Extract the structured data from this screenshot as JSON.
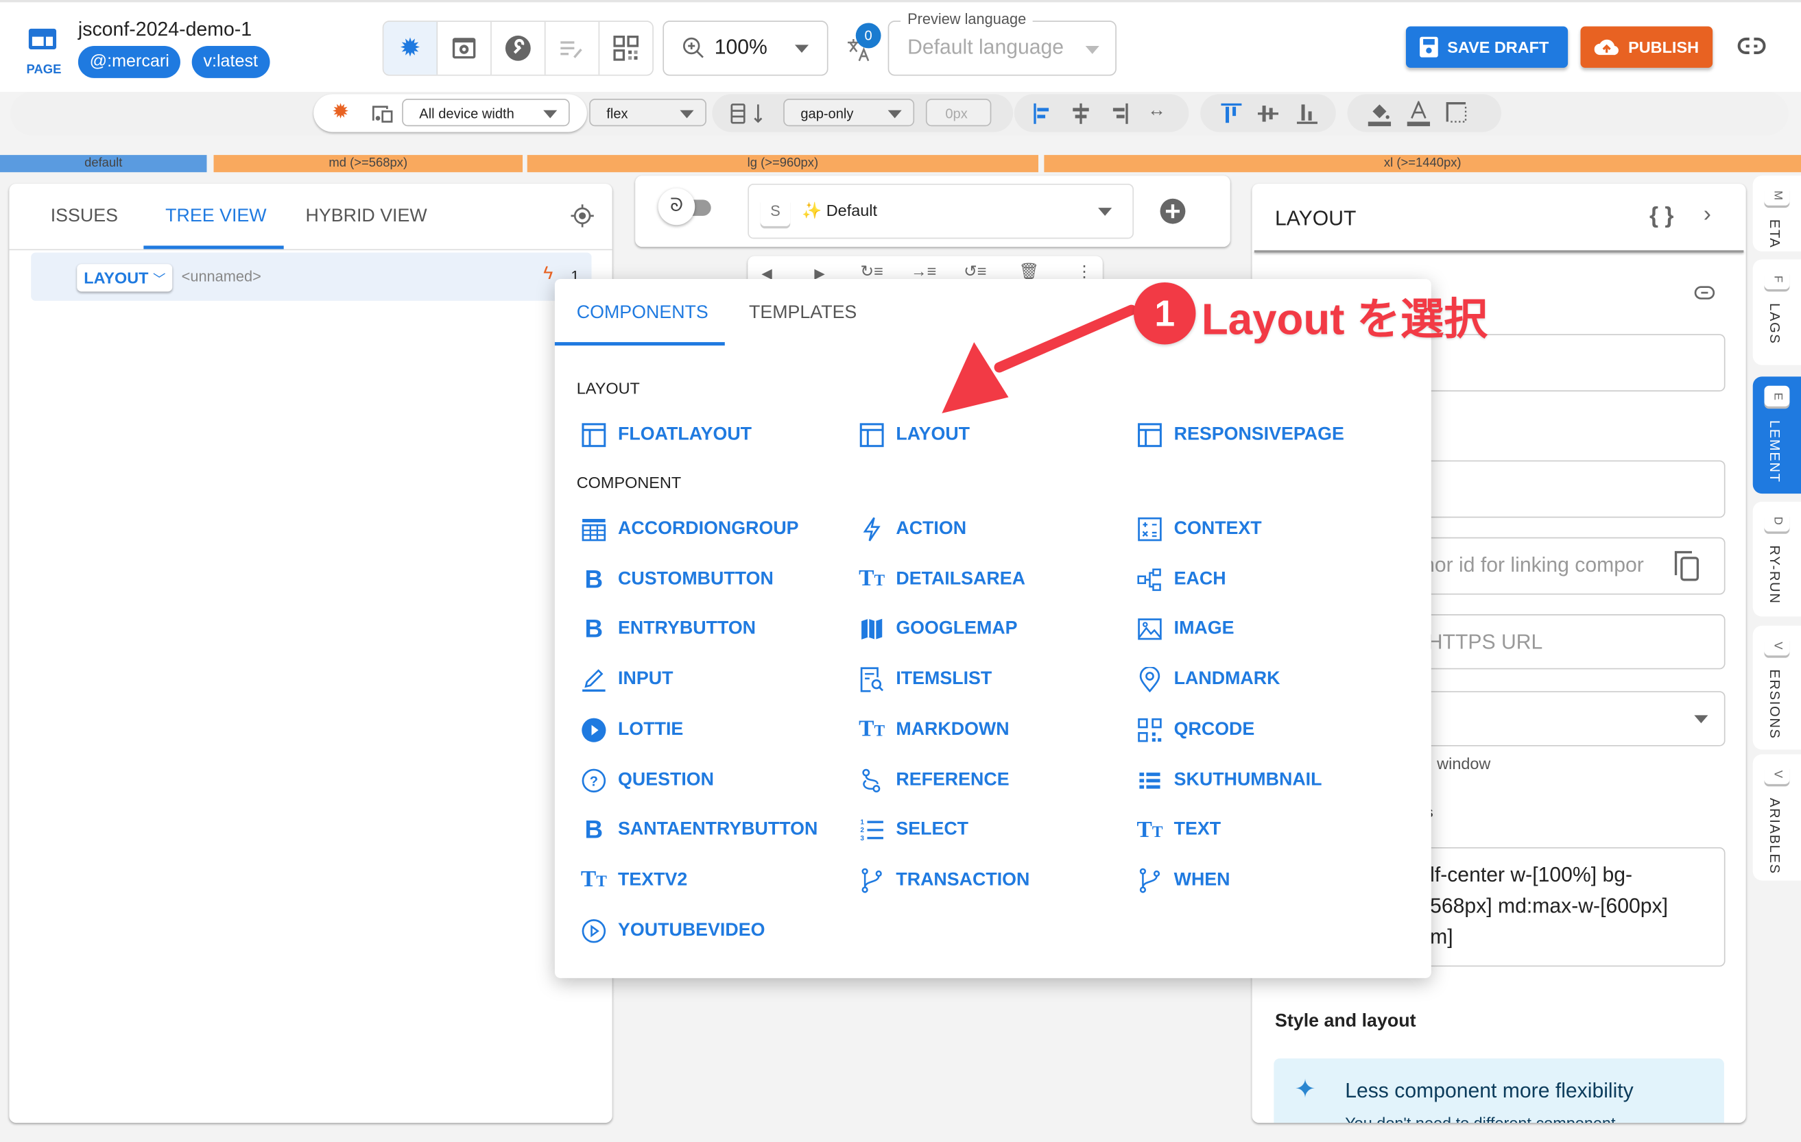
{
  "header": {
    "page_label": "PAGE",
    "title": "jsconf-2024-demo-1",
    "chips": [
      "@:mercari",
      "v:latest"
    ],
    "zoom_value": "100%",
    "translation_badge": "0",
    "preview_language_label": "Preview language",
    "preview_language_value": "Default language",
    "save_label": "SAVE DRAFT",
    "publish_label": "PUBLISH"
  },
  "toolbar": {
    "device_width": "All device width",
    "display": "flex",
    "gap_mode": "gap-only",
    "gap_value": "0px"
  },
  "breakpoints": [
    "default",
    "md (>=568px)",
    "lg (>=960px)",
    "xl (>=1440px)"
  ],
  "left_panel": {
    "tabs": [
      "ISSUES",
      "TREE VIEW",
      "HYBRID VIEW"
    ],
    "active_tab": "TREE VIEW",
    "tree_node_type": "LAYOUT",
    "tree_node_name": "<unnamed>",
    "tree_node_count": "1"
  },
  "canvas": {
    "style_key": "S",
    "style_value": "✨ Default"
  },
  "popup": {
    "tabs": [
      "COMPONENTS",
      "TEMPLATES"
    ],
    "active_tab": "COMPONENTS",
    "layout_section": "LAYOUT",
    "layout_items": [
      {
        "label": "FLOATLAYOUT",
        "icon": "layout-icon"
      },
      {
        "label": "LAYOUT",
        "icon": "layout-icon"
      },
      {
        "label": "RESPONSIVEPAGE",
        "icon": "layout-icon"
      }
    ],
    "component_section": "COMPONENT",
    "component_items": [
      {
        "label": "ACCORDIONGROUP",
        "icon": "table-icon"
      },
      {
        "label": "ACTION",
        "icon": "bolt-icon"
      },
      {
        "label": "CONTEXT",
        "icon": "calculator-icon"
      },
      {
        "label": "CUSTOMBUTTON",
        "icon": "bold-b-icon"
      },
      {
        "label": "DETAILSAREA",
        "icon": "text-icon"
      },
      {
        "label": "EACH",
        "icon": "tree-icon"
      },
      {
        "label": "ENTRYBUTTON",
        "icon": "bold-b-icon"
      },
      {
        "label": "GOOGLEMAP",
        "icon": "map-icon"
      },
      {
        "label": "IMAGE",
        "icon": "image-icon"
      },
      {
        "label": "INPUT",
        "icon": "pencil-icon"
      },
      {
        "label": "ITEMSLIST",
        "icon": "list-search-icon"
      },
      {
        "label": "LANDMARK",
        "icon": "location-pin-icon"
      },
      {
        "label": "LOTTIE",
        "icon": "play-circle-icon"
      },
      {
        "label": "MARKDOWN",
        "icon": "text-icon"
      },
      {
        "label": "QRCODE",
        "icon": "qrcode-icon"
      },
      {
        "label": "QUESTION",
        "icon": "help-circle-icon"
      },
      {
        "label": "REFERENCE",
        "icon": "link-nodes-icon"
      },
      {
        "label": "SKUTHUMBNAIL",
        "icon": "list-icon"
      },
      {
        "label": "SANTAENTRYBUTTON",
        "icon": "bold-b-icon"
      },
      {
        "label": "SELECT",
        "icon": "numbered-list-icon"
      },
      {
        "label": "TEXT",
        "icon": "text-icon"
      },
      {
        "label": "TEXTV2",
        "icon": "text-icon"
      },
      {
        "label": "TRANSACTION",
        "icon": "branch-icon"
      },
      {
        "label": "WHEN",
        "icon": "branch-icon"
      },
      {
        "label": "YOUTUBEVIDEO",
        "icon": "play-outline-icon"
      }
    ]
  },
  "annotation": {
    "number": "1",
    "text": "Layout を選択"
  },
  "right_panel": {
    "title": "LAYOUT",
    "anchor_placeholder": "nor id for linking compor",
    "url_placeholder": "HTTPS URL",
    "window_hint": "window",
    "classes_label_fragment": "s",
    "classes_value": "lf-center w-[100%] bg-\n568px] md:max-w-[600px]\nm]",
    "style_section": "Style and layout",
    "info_title": "Less component more flexibility",
    "info_body": "You don't need to different component"
  },
  "side_tabs": [
    {
      "key": "M",
      "label": "ETA"
    },
    {
      "key": "F",
      "label": "LAGS"
    },
    {
      "key": "E",
      "label": "LEMENT",
      "active": true
    },
    {
      "key": "D",
      "label": "RY-RUN"
    },
    {
      "key": "V",
      "label": "ERSIONS"
    },
    {
      "key": "V",
      "label": "ARIABLES"
    }
  ],
  "colors": {
    "primary": "#1f7ae0",
    "publish": "#e86222",
    "annotation": "#f23a45",
    "bp_default": "#5a9be0",
    "bp_other": "#f9a95e"
  }
}
